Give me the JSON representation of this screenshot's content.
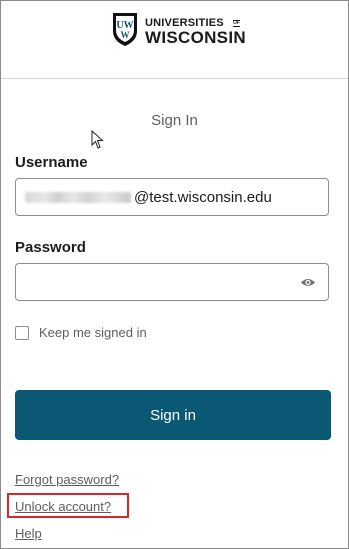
{
  "brand": {
    "logo_line1": "UNIVERSITIES",
    "logo_of": "OF",
    "logo_line2": "WISCONSIN",
    "shield_letters": "UW",
    "primary_color": "#0a5874",
    "highlight_color": "#d9262c"
  },
  "form": {
    "title": "Sign In",
    "username_label": "Username",
    "username_value_visible": "@test.wisconsin.edu",
    "password_label": "Password",
    "password_value": "",
    "keep_signed_in_label": "Keep me signed in",
    "keep_signed_in_checked": false,
    "submit_label": "Sign in"
  },
  "links": {
    "forgot_password": "Forgot password?",
    "unlock_account": "Unlock account?",
    "help": "Help"
  },
  "icons": {
    "show_password": "eye-icon",
    "logo": "uw-shield-icon",
    "pointer": "mouse-cursor-icon"
  }
}
